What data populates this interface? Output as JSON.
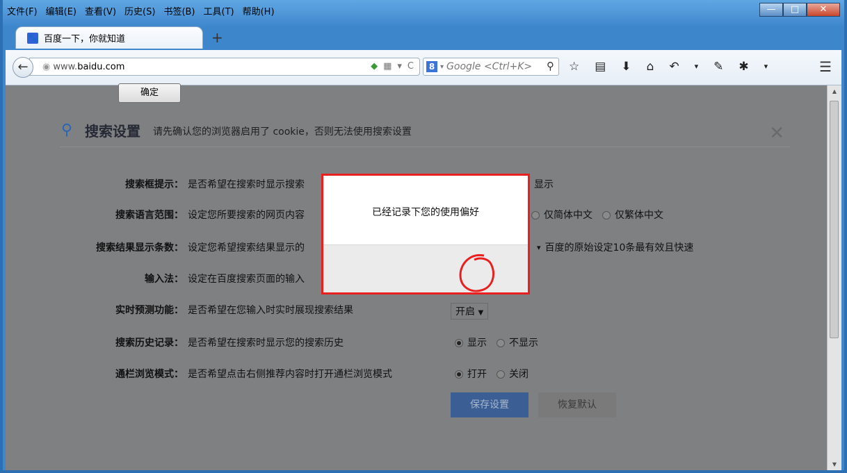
{
  "menubar": [
    "文件(F)",
    "编辑(E)",
    "查看(V)",
    "历史(S)",
    "书签(B)",
    "工具(T)",
    "帮助(H)"
  ],
  "window_controls": {
    "minimize": "—",
    "maximize": "□",
    "close": "✕"
  },
  "tab": {
    "title": "百度一下，你就知道",
    "icon": "🐾",
    "new_tab": "+"
  },
  "nav": {
    "back": "←",
    "url_host": "www.",
    "url_domain": "baidu.com",
    "search_placeholder": "Google <Ctrl+K>",
    "menu": "☰",
    "toolbar_icons": [
      "star-icon",
      "reading-list-icon",
      "download-icon",
      "home-icon",
      "undo-icon",
      "dropdown-icon",
      "notepad-icon",
      "plugin-icon",
      "dropdown-icon"
    ]
  },
  "settings": {
    "title": "搜索设置",
    "subtitle": "请先确认您的浏览器启用了 cookie，否则无法使用搜索设置",
    "rows": [
      {
        "label": "搜索框提示：",
        "desc": "是否希望在搜索时显示搜索",
        "opts": "显示"
      },
      {
        "label": "搜索语言范围：",
        "desc": "设定您所要搜索的网页内容",
        "opt_a": "仅简体中文",
        "opt_b": "仅繁体中文"
      },
      {
        "label": "搜索结果显示条数：",
        "desc": "设定您希望搜索结果显示的",
        "note": "百度的原始设定10条最有效且快速"
      },
      {
        "label": "输入法：",
        "desc": "设定在百度搜索页面的输入"
      },
      {
        "label": "实时预测功能：",
        "desc": "是否希望在您输入时实时展现搜索结果",
        "select": "开启"
      },
      {
        "label": "搜索历史记录：",
        "desc": "是否希望在搜索时显示您的搜索历史",
        "opt_a": "显示",
        "opt_b": "不显示"
      },
      {
        "label": "通栏浏览模式：",
        "desc": "是否希望点击右侧推荐内容时打开通栏浏览模式",
        "opt_a": "打开",
        "opt_b": "关闭"
      }
    ],
    "save_button": "保存设置",
    "reset_button": "恢复默认"
  },
  "dialog": {
    "message": "已经记录下您的使用偏好",
    "ok": "确定"
  },
  "colors": {
    "highlight": "#e8201f",
    "primary": "#3b5f95",
    "overlay": "#7f8082"
  }
}
